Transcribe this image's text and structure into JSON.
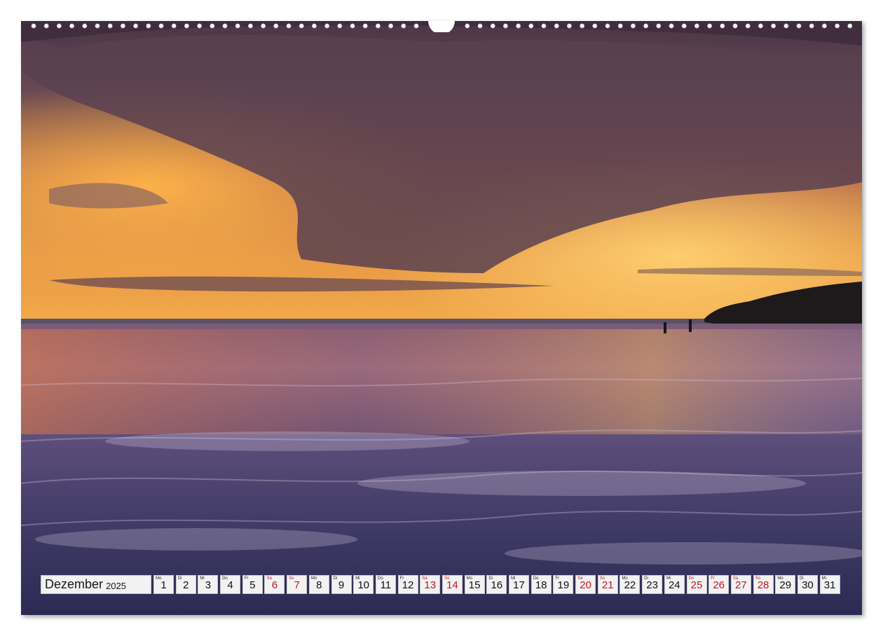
{
  "calendar": {
    "month": "Dezember",
    "year": "2025",
    "weekend_color": "#c8171e",
    "days": [
      {
        "d": "1",
        "wd": "Mo",
        "weekend": false
      },
      {
        "d": "2",
        "wd": "Di",
        "weekend": false
      },
      {
        "d": "3",
        "wd": "Mi",
        "weekend": false
      },
      {
        "d": "4",
        "wd": "Do",
        "weekend": false
      },
      {
        "d": "5",
        "wd": "Fr",
        "weekend": false
      },
      {
        "d": "6",
        "wd": "Sa",
        "weekend": true
      },
      {
        "d": "7",
        "wd": "So",
        "weekend": true
      },
      {
        "d": "8",
        "wd": "Mo",
        "weekend": false
      },
      {
        "d": "9",
        "wd": "Di",
        "weekend": false
      },
      {
        "d": "10",
        "wd": "Mi",
        "weekend": false
      },
      {
        "d": "11",
        "wd": "Do",
        "weekend": false
      },
      {
        "d": "12",
        "wd": "Fr",
        "weekend": false
      },
      {
        "d": "13",
        "wd": "Sa",
        "weekend": true
      },
      {
        "d": "14",
        "wd": "So",
        "weekend": true
      },
      {
        "d": "15",
        "wd": "Mo",
        "weekend": false
      },
      {
        "d": "16",
        "wd": "Di",
        "weekend": false
      },
      {
        "d": "17",
        "wd": "Mi",
        "weekend": false
      },
      {
        "d": "18",
        "wd": "Do",
        "weekend": false
      },
      {
        "d": "19",
        "wd": "Fr",
        "weekend": false
      },
      {
        "d": "20",
        "wd": "Sa",
        "weekend": true
      },
      {
        "d": "21",
        "wd": "So",
        "weekend": true
      },
      {
        "d": "22",
        "wd": "Mo",
        "weekend": false
      },
      {
        "d": "23",
        "wd": "Di",
        "weekend": false
      },
      {
        "d": "24",
        "wd": "Mi",
        "weekend": false
      },
      {
        "d": "25",
        "wd": "Do",
        "weekend": true
      },
      {
        "d": "26",
        "wd": "Fr",
        "weekend": true
      },
      {
        "d": "27",
        "wd": "Sa",
        "weekend": true
      },
      {
        "d": "28",
        "wd": "So",
        "weekend": true
      },
      {
        "d": "29",
        "wd": "Mo",
        "weekend": false
      },
      {
        "d": "30",
        "wd": "Di",
        "weekend": false
      },
      {
        "d": "31",
        "wd": "Mi",
        "weekend": false
      }
    ]
  }
}
